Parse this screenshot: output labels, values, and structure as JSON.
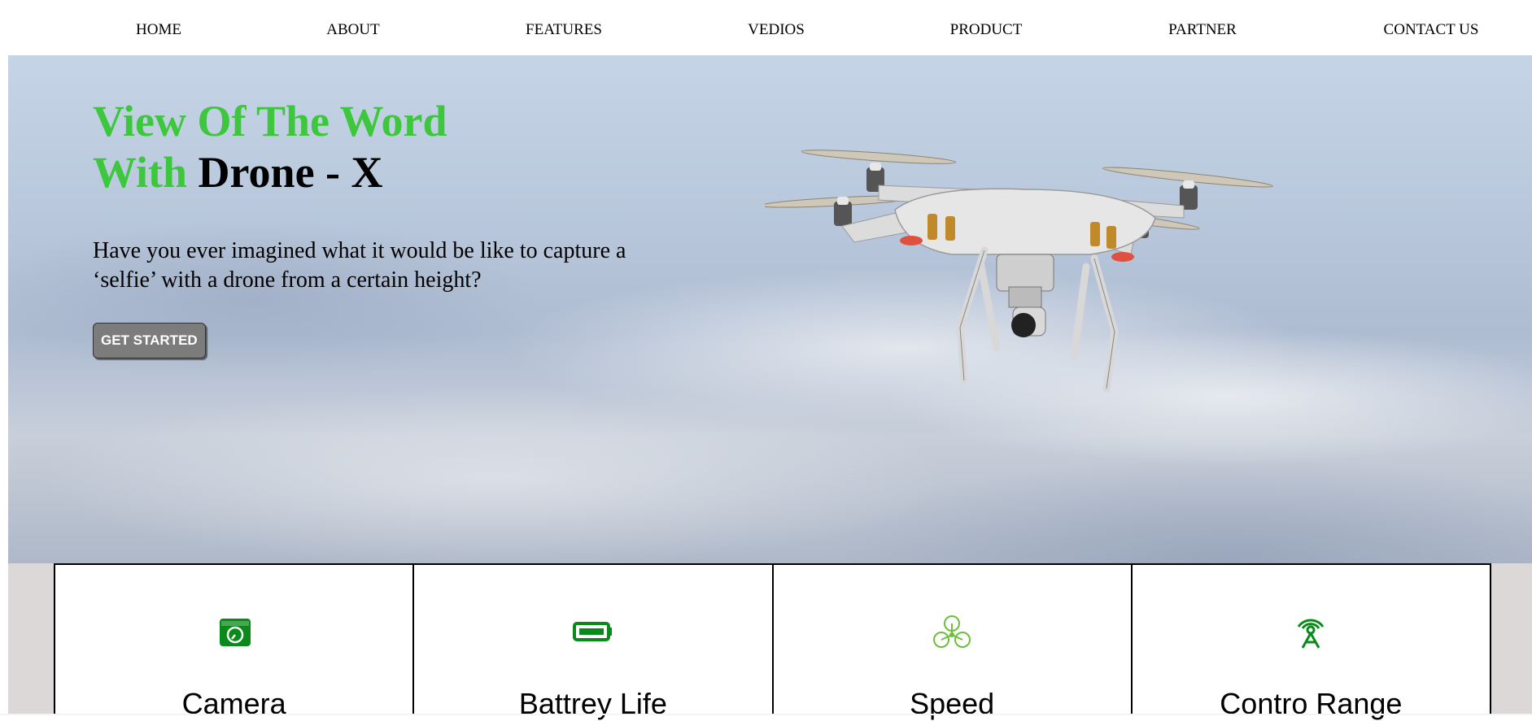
{
  "nav": {
    "items": [
      "HOME",
      "ABOUT",
      "FEATURES",
      "VEDIOS",
      "PRODUCT",
      "PARTNER",
      "CONTACT US"
    ]
  },
  "hero": {
    "title_line1": "View Of The Word",
    "title_with": "With",
    "title_brand": "Drone - X",
    "text_line1": "Have you ever imagined what it would be like to capture a",
    "text_line2": "‘selfie’ with a drone from a certain height?",
    "button_label": "GET STARTED"
  },
  "features": [
    {
      "title": "Camera",
      "icon": "camera-icon"
    },
    {
      "title": "Battrey Life",
      "icon": "battery-icon"
    },
    {
      "title": "Speed",
      "icon": "drone-propeller-icon"
    },
    {
      "title": "Contro Range",
      "icon": "signal-tower-icon"
    }
  ],
  "colors": {
    "accent_green": "#3cc73c",
    "icon_green": "#0a8a1a",
    "button_gray": "#7c7c7c"
  }
}
